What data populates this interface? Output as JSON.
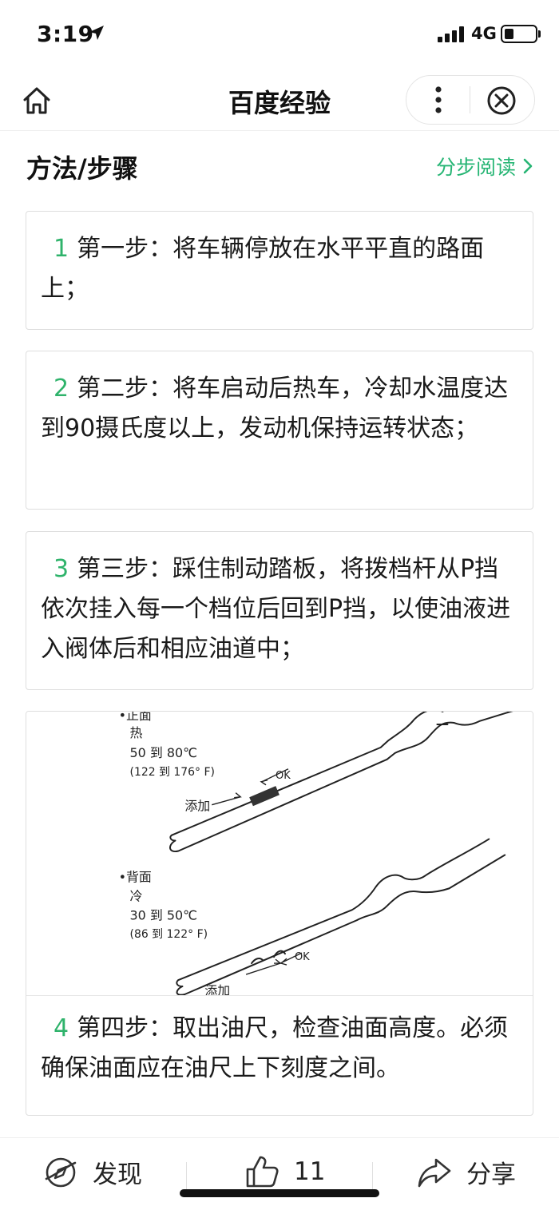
{
  "status_bar": {
    "time": "3:19",
    "network": "4G",
    "battery_level": 0.3
  },
  "header": {
    "title": "百度经验",
    "home_icon": "home-icon",
    "more_icon": "more-vertical-icon",
    "close_icon": "close-circle-icon"
  },
  "section": {
    "title": "方法/步骤",
    "step_read_label": "分步阅读"
  },
  "steps": [
    {
      "num": "1",
      "text": "第一步：将车辆停放在水平平直的路面上；"
    },
    {
      "num": "2",
      "text": "第二步：将车启动后热车，冷却水温度达到90摄氏度以上，发动机保持运转状态；"
    },
    {
      "num": "3",
      "text": "第三步：踩住制动踏板，将拨档杆从P挡依次挂入每一个档位后回到P挡，以使油液进入阀体后和相应油道中；"
    },
    {
      "num": "4",
      "text": "第四步：取出油尺，检查油面高度。必须确保油面应在油尺上下刻度之间。"
    }
  ],
  "illustration": {
    "front": {
      "label": "•正面",
      "temp_label": "热",
      "celsius": "50 到 80℃",
      "fahrenheit": "(122 到 176° F)",
      "ok": "OK",
      "add": "添加"
    },
    "back": {
      "label": "•背面",
      "temp_label": "冷",
      "celsius": "30 到 50℃",
      "fahrenheit": "(86 到 122° F)",
      "ok": "OK",
      "add": "添加"
    }
  },
  "bottom_bar": {
    "discover_label": "发现",
    "like_count": "11",
    "share_label": "分享"
  },
  "colors": {
    "accent_green": "#26b574",
    "step_number_green": "#2fb36b"
  }
}
